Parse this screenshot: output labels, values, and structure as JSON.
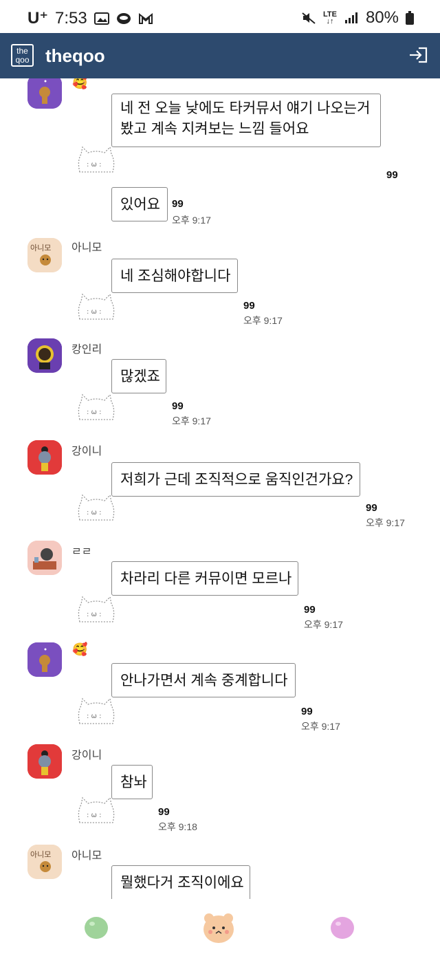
{
  "status": {
    "carrier": "U⁺",
    "time": "7:53",
    "lte": "LTE",
    "battery": "80%"
  },
  "app": {
    "title": "theqoo",
    "logo_line1": "the",
    "logo_line2": "qoo"
  },
  "messages": [
    {
      "nick": "",
      "emoji": "🥰",
      "avatar_color": "#7a4fbf",
      "lines": [
        "네 전 오늘 낮에도 타커뮤서 얘기 나오는거",
        "봤고 계속 지켜보는 느낌 들어요"
      ],
      "count": "99",
      "time": ""
    },
    {
      "nick": "",
      "emoji": "",
      "avatar_color": "",
      "lines": [
        "있어요"
      ],
      "count": "99",
      "time": "오후 9:17"
    },
    {
      "nick": "아니모",
      "emoji": "",
      "avatar_color": "#f4dcc4",
      "avatar_label": "아니모",
      "lines": [
        "네 조심해야합니다"
      ],
      "count": "99",
      "time": "오후 9:17"
    },
    {
      "nick": "캉인리",
      "emoji": "",
      "avatar_color": "#6a3fb0",
      "lines": [
        "많겠죠"
      ],
      "count": "99",
      "time": "오후 9:17"
    },
    {
      "nick": "강이니",
      "emoji": "",
      "avatar_color": "#e23a3a",
      "lines": [
        "저희가 근데 조직적으로 움직인건가요?"
      ],
      "count": "99",
      "time": "오후 9:17"
    },
    {
      "nick": "ㄹㄹ",
      "emoji": "",
      "avatar_color": "#f5c9c0",
      "lines": [
        "차라리 다른 커뮤이면 모르나"
      ],
      "count": "99",
      "time": "오후 9:17"
    },
    {
      "nick": "",
      "emoji": "🥰",
      "avatar_color": "#7a4fbf",
      "lines": [
        "안나가면서 계속 중계합니다"
      ],
      "count": "99",
      "time": "오후 9:17"
    },
    {
      "nick": "강이니",
      "emoji": "",
      "avatar_color": "#e23a3a",
      "lines": [
        "참놔"
      ],
      "count": "99",
      "time": "오후 9:18"
    },
    {
      "nick": "아니모",
      "emoji": "",
      "avatar_color": "#f4dcc4",
      "avatar_label": "아니모",
      "lines": [
        "뭘했다거 조직이에요"
      ],
      "count": "",
      "time": ""
    }
  ],
  "nav": {
    "left_color": "#9fd39a",
    "center_color": "#f6c9a0",
    "right_color": "#e4a5e0"
  }
}
